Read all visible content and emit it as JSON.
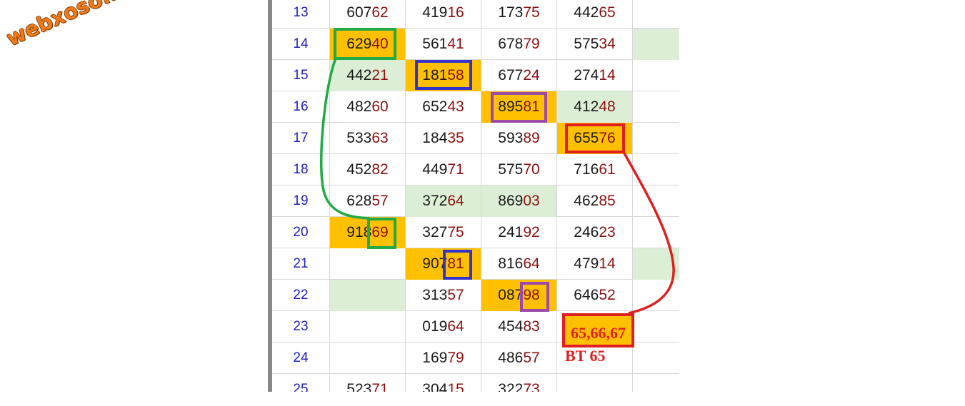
{
  "watermark": "webxoso.net",
  "rows": [
    {
      "day": "13",
      "cells": [
        {
          "h": "607",
          "t": "62",
          "bg": ""
        },
        {
          "h": "419",
          "t": "16",
          "bg": ""
        },
        {
          "h": "173",
          "t": "75",
          "bg": ""
        },
        {
          "h": "442",
          "t": "65",
          "bg": ""
        }
      ],
      "right": ""
    },
    {
      "day": "14",
      "cells": [
        {
          "h": "629",
          "t": "40",
          "bg": "hl"
        },
        {
          "h": "561",
          "t": "41",
          "bg": ""
        },
        {
          "h": "678",
          "t": "79",
          "bg": ""
        },
        {
          "h": "575",
          "t": "34",
          "bg": ""
        }
      ],
      "right": "gr"
    },
    {
      "day": "15",
      "cells": [
        {
          "h": "442",
          "t": "21",
          "bg": "gr"
        },
        {
          "h": "181",
          "t": "58",
          "bg": "hl"
        },
        {
          "h": "677",
          "t": "24",
          "bg": ""
        },
        {
          "h": "274",
          "t": "14",
          "bg": ""
        }
      ],
      "right": ""
    },
    {
      "day": "16",
      "cells": [
        {
          "h": "482",
          "t": "60",
          "bg": ""
        },
        {
          "h": "652",
          "t": "43",
          "bg": ""
        },
        {
          "h": "895",
          "t": "81",
          "bg": "hl"
        },
        {
          "h": "412",
          "t": "48",
          "bg": "gr"
        }
      ],
      "right": ""
    },
    {
      "day": "17",
      "cells": [
        {
          "h": "533",
          "t": "63",
          "bg": ""
        },
        {
          "h": "184",
          "t": "35",
          "bg": ""
        },
        {
          "h": "593",
          "t": "89",
          "bg": ""
        },
        {
          "h": "655",
          "t": "76",
          "bg": "hl"
        }
      ],
      "right": ""
    },
    {
      "day": "18",
      "cells": [
        {
          "h": "452",
          "t": "82",
          "bg": ""
        },
        {
          "h": "449",
          "t": "71",
          "bg": ""
        },
        {
          "h": "575",
          "t": "70",
          "bg": ""
        },
        {
          "h": "716",
          "t": "61",
          "bg": ""
        }
      ],
      "right": ""
    },
    {
      "day": "19",
      "cells": [
        {
          "h": "628",
          "t": "57",
          "bg": ""
        },
        {
          "h": "372",
          "t": "64",
          "bg": "gr"
        },
        {
          "h": "869",
          "t": "03",
          "bg": "gr"
        },
        {
          "h": "462",
          "t": "85",
          "bg": ""
        }
      ],
      "right": ""
    },
    {
      "day": "20",
      "cells": [
        {
          "h": "918",
          "t": "69",
          "bg": "hl"
        },
        {
          "h": "327",
          "t": "75",
          "bg": ""
        },
        {
          "h": "241",
          "t": "92",
          "bg": ""
        },
        {
          "h": "246",
          "t": "23",
          "bg": ""
        }
      ],
      "right": ""
    },
    {
      "day": "21",
      "cells": [
        {
          "h": "",
          "t": "",
          "bg": ""
        },
        {
          "h": "907",
          "t": "81",
          "bg": "hl"
        },
        {
          "h": "816",
          "t": "64",
          "bg": ""
        },
        {
          "h": "479",
          "t": "14",
          "bg": ""
        }
      ],
      "right": "gr"
    },
    {
      "day": "22",
      "cells": [
        {
          "h": "",
          "t": "",
          "bg": "gr"
        },
        {
          "h": "313",
          "t": "57",
          "bg": ""
        },
        {
          "h": "087",
          "t": "98",
          "bg": "hl"
        },
        {
          "h": "646",
          "t": "52",
          "bg": ""
        }
      ],
      "right": ""
    },
    {
      "day": "23",
      "cells": [
        {
          "h": "",
          "t": "",
          "bg": ""
        },
        {
          "h": "019",
          "t": "64",
          "bg": ""
        },
        {
          "h": "454",
          "t": "83",
          "bg": ""
        },
        {
          "h": "",
          "t": "",
          "bg": ""
        }
      ],
      "right": ""
    },
    {
      "day": "24",
      "cells": [
        {
          "h": "",
          "t": "",
          "bg": ""
        },
        {
          "h": "169",
          "t": "79",
          "bg": ""
        },
        {
          "h": "486",
          "t": "57",
          "bg": ""
        },
        {
          "h": "",
          "t": "",
          "bg": ""
        }
      ],
      "right": ""
    },
    {
      "day": "25",
      "cells": [
        {
          "h": "523",
          "t": "71",
          "bg": ""
        },
        {
          "h": "304",
          "t": "15",
          "bg": ""
        },
        {
          "h": "322",
          "t": "73",
          "bg": ""
        },
        {
          "h": "",
          "t": "",
          "bg": ""
        }
      ],
      "right": ""
    }
  ],
  "prediction": "65,66,67",
  "bt_note": "BT 65",
  "colors": {
    "highlight": "#ffc000",
    "soft_green": "#dcefd6",
    "tail_digits": "#8b1010",
    "day_numbers": "#2020c0",
    "green_marker": "#22aa44",
    "blue_marker": "#3333cc",
    "purple_marker": "#9b4aa8",
    "red_marker": "#e02020"
  }
}
